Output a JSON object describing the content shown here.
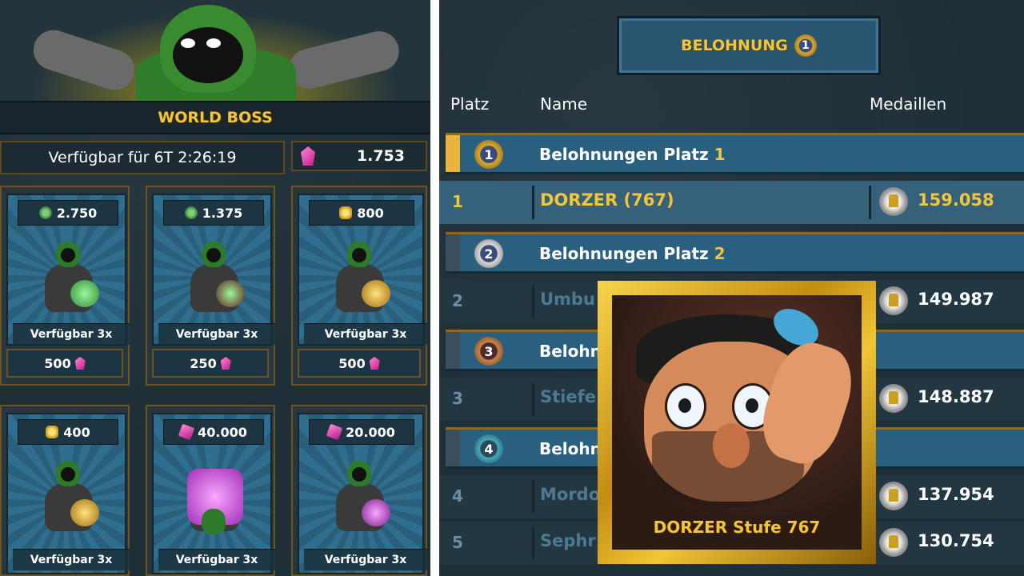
{
  "left": {
    "title": "WORLD BOSS",
    "timer": "Verfügbar für 6T 2:26:19",
    "gems": "1.753",
    "items": [
      {
        "price": "2.750",
        "currency": "green-gem-icon",
        "availability": "Verfügbar 3x",
        "cost": "500"
      },
      {
        "price": "1.375",
        "currency": "green-gem-icon",
        "availability": "Verfügbar 3x",
        "cost": "250"
      },
      {
        "price": "800",
        "currency": "gold-coin-icon",
        "availability": "Verfügbar 3x",
        "cost": "500"
      },
      {
        "price": "400",
        "currency": "gold-coin-icon",
        "availability": "Verfügbar 3x"
      },
      {
        "price": "40.000",
        "currency": "pink-crystal-icon",
        "availability": "Verfügbar 3x"
      },
      {
        "price": "20.000",
        "currency": "pink-crystal-icon",
        "availability": "Verfügbar 3x"
      }
    ]
  },
  "right": {
    "header_title": "BELOHNUNG",
    "header_badge": "1",
    "columns": {
      "rank": "Platz",
      "name": "Name",
      "medals": "Medaillen"
    },
    "categories": [
      {
        "label": "Belohnungen Platz",
        "num": "1",
        "badge": "1"
      },
      {
        "label": "Belohnungen Platz",
        "num": "2",
        "badge": "2"
      },
      {
        "label": "Belohnh",
        "badge": "3"
      },
      {
        "label": "Belohn",
        "badge": "4"
      }
    ],
    "rows": [
      {
        "rank": "1",
        "name": "DORZER (767)",
        "medals": "159.058"
      },
      {
        "rank": "2",
        "name": "Umbu",
        "medals": "149.987"
      },
      {
        "rank": "3",
        "name": "Stiefe",
        "medals": "148.887"
      },
      {
        "rank": "4",
        "name": "Mordo",
        "medals": "137.954"
      },
      {
        "rank": "5",
        "name": "Sephr",
        "medals": "130.754"
      }
    ],
    "profile_label": "DORZER Stufe 767"
  },
  "colors": {
    "gold": "#f3c63a",
    "panel": "#1f2f38",
    "row_blue": "#2a5f80"
  }
}
